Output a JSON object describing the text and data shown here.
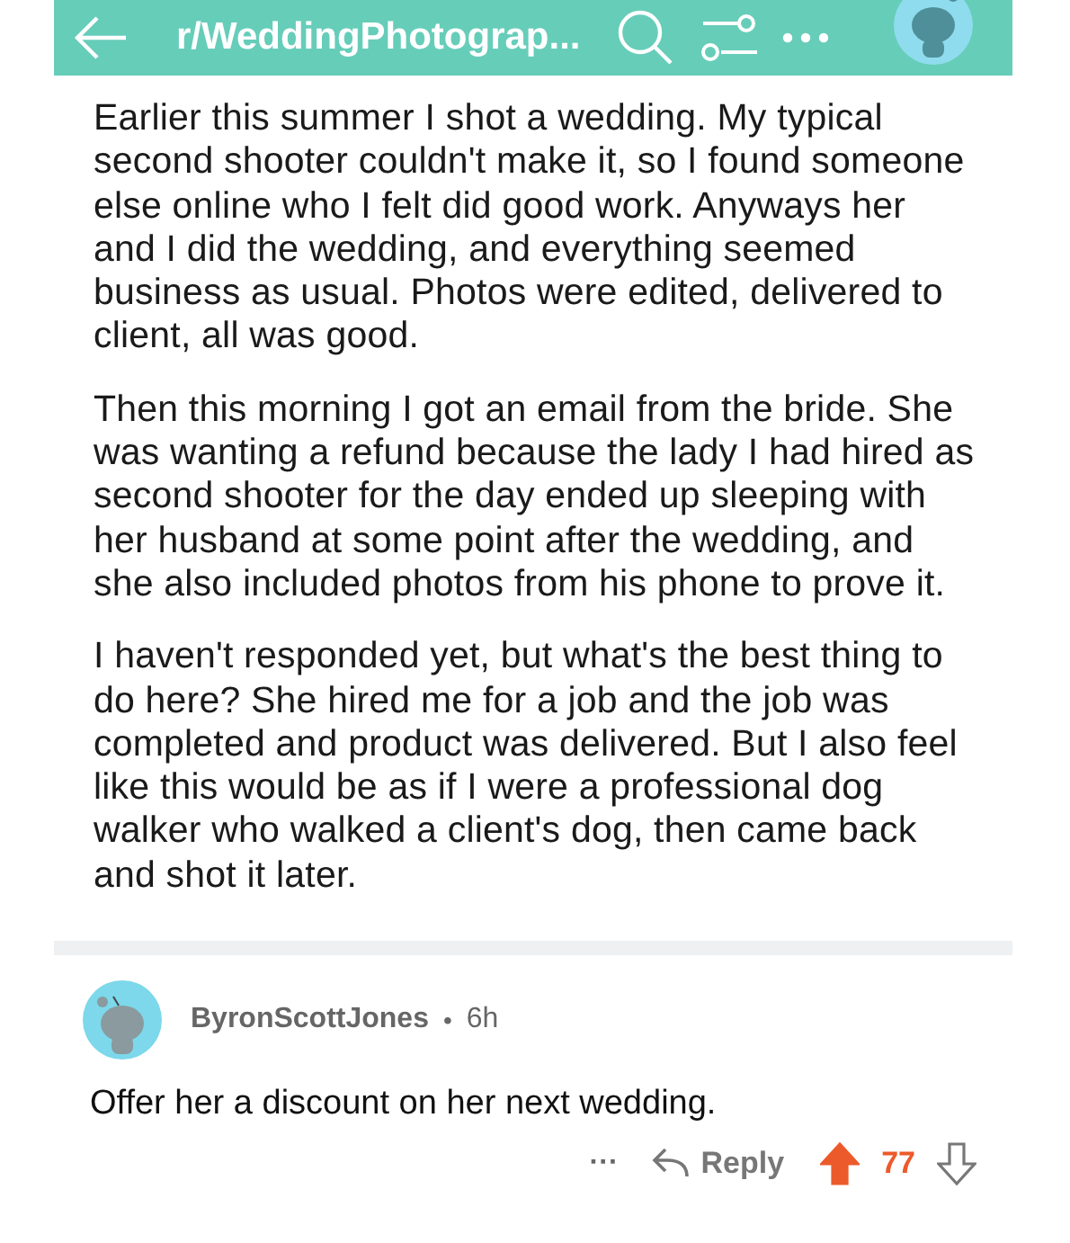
{
  "header": {
    "title": "r/WeddingPhotograp..."
  },
  "post": {
    "paragraphs": [
      "Earlier this summer I shot a wedding. My typical second shooter couldn't make it, so I found someone else online who I felt did good work. Anyways her and I did the wedding, and everything seemed business as usual. Photos were edited, delivered to client, all was good.",
      "Then this morning I got an email from the bride.  She was wanting a refund because the lady I had hired as second shooter for the day ended up sleeping with her husband at some point after the wedding, and she also included photos from his phone to prove it.",
      "I haven't responded yet, but what's the best thing to do here? She hired me for a job and the job was completed and product was delivered.  But I also feel like this would be as if I were a professional dog walker who walked a client's dog, then came back and shot it later."
    ]
  },
  "comment": {
    "author": "ByronScottJones",
    "separator": "•",
    "age": "6h",
    "body": "Offer her a discount on her next wedding.",
    "more": "···",
    "reply": "Reply",
    "upvoted": true,
    "score": "77"
  }
}
